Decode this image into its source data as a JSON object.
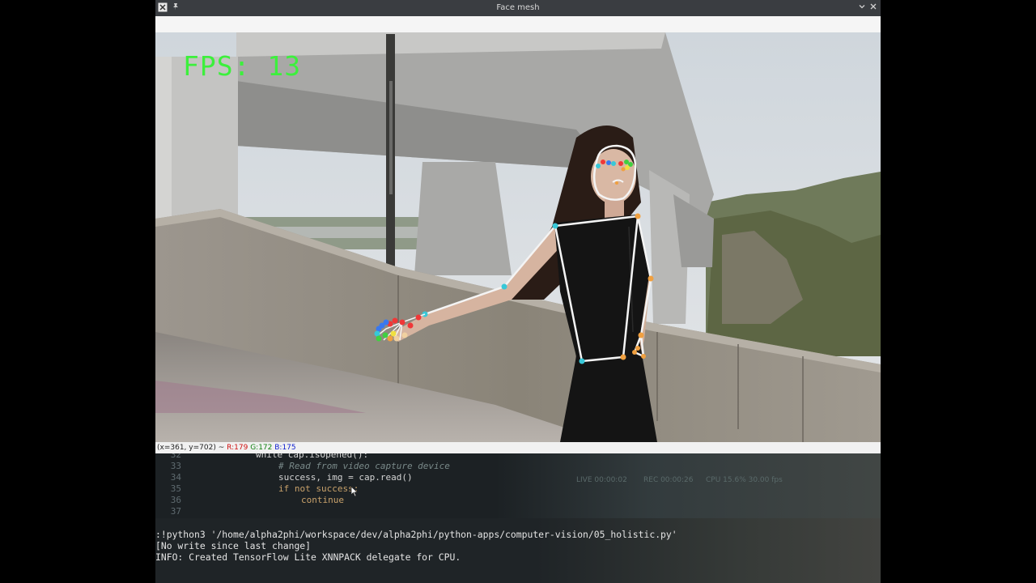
{
  "window": {
    "title": "Face mesh"
  },
  "overlay": {
    "fps_text": "FPS: 13"
  },
  "statusbar": {
    "coords": "(x=361, y=702) ~",
    "r": "R:179",
    "g": "G:172",
    "b": "B:175"
  },
  "editor": {
    "lines": [
      {
        "num": "32",
        "code": "while cap.isOpened():"
      },
      {
        "num": "33",
        "code": "# Read from video capture device"
      },
      {
        "num": "34",
        "code": "success, img = cap.read()"
      },
      {
        "num": "35",
        "code": "if not success:"
      },
      {
        "num": "36",
        "code": "continue"
      },
      {
        "num": "37",
        "code": ""
      }
    ],
    "faint_labels": {
      "live": "LIVE 00:00:02",
      "rec": "REC 00:00:26",
      "cpu": "CPU 15.6%  30.00 fps"
    }
  },
  "terminal": {
    "lines": [
      ":!python3 '/home/alpha2phi/workspace/dev/alpha2phi/python-apps/computer-vision/05_holistic.py'",
      "[No write since last change]",
      "INFO: Created TensorFlow Lite XNNPACK delegate for CPU."
    ]
  },
  "colors": {
    "fps": "#3cf03c",
    "titlebar": "#3a3d41",
    "landmark_cyan": "#38c8d8",
    "landmark_orange": "#f0a040",
    "skeleton": "#f4f4f4"
  }
}
